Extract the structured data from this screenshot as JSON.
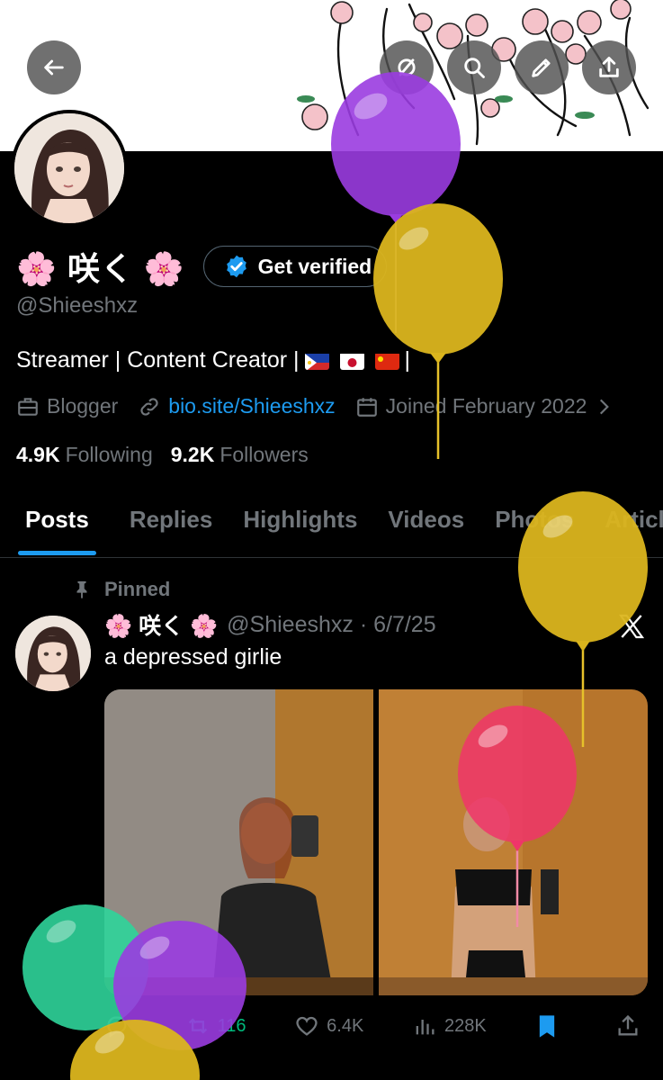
{
  "header": {
    "back_label": "Back",
    "icons": [
      "arrow-left-icon",
      "grok-slash-icon",
      "search-icon",
      "edit-icon",
      "share-icon"
    ]
  },
  "profile": {
    "display_name": "🌸 咲く 🌸",
    "verify_label": "Get verified",
    "handle": "@Shieeshxz",
    "bio_text": "Streamer | Content Creator |",
    "bio_end": "|",
    "category": "Blogger",
    "link": "bio.site/Shieeshxz",
    "joined": "Joined February 2022",
    "following_count": "4.9K",
    "following_label": "Following",
    "followers_count": "9.2K",
    "followers_label": "Followers"
  },
  "tabs": [
    {
      "label": "Posts"
    },
    {
      "label": "Replies"
    },
    {
      "label": "Highlights"
    },
    {
      "label": "Videos"
    },
    {
      "label": "Photos"
    },
    {
      "label": "Articles"
    }
  ],
  "post": {
    "pinned_label": "Pinned",
    "author": "🌸 咲く 🌸",
    "handle_date": "@Shieeshxz · 6/7/25",
    "text": "a depressed girlie",
    "reposts": "116",
    "likes": "6.4K",
    "views": "228K"
  },
  "colors": {
    "accent": "#1d9bf0",
    "repost": "#00ba7c",
    "muted": "#71767b",
    "background": "#000000"
  }
}
